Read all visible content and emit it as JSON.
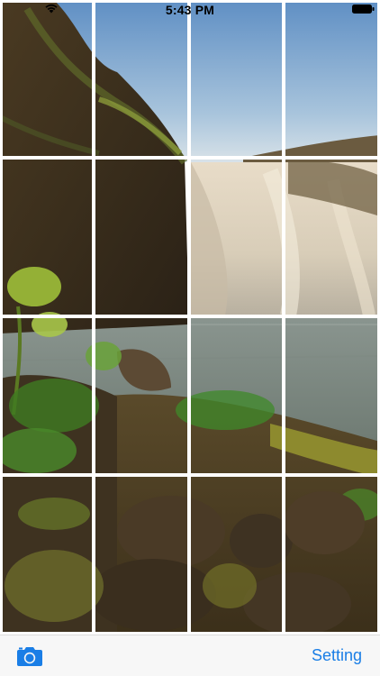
{
  "status_bar": {
    "time": "5:43 PM",
    "wifi_icon": "wifi-icon",
    "battery_icon": "battery-icon"
  },
  "puzzle": {
    "columns": 4,
    "rows": 4,
    "image_description_icon": "waterfall-landscape-photo"
  },
  "toolbar": {
    "camera_icon": "camera-icon",
    "setting_label": "Setting"
  },
  "colors": {
    "accent": "#1a7ee6",
    "toolbar_bg": "#f7f7f7",
    "grid_line": "#ffffff"
  }
}
